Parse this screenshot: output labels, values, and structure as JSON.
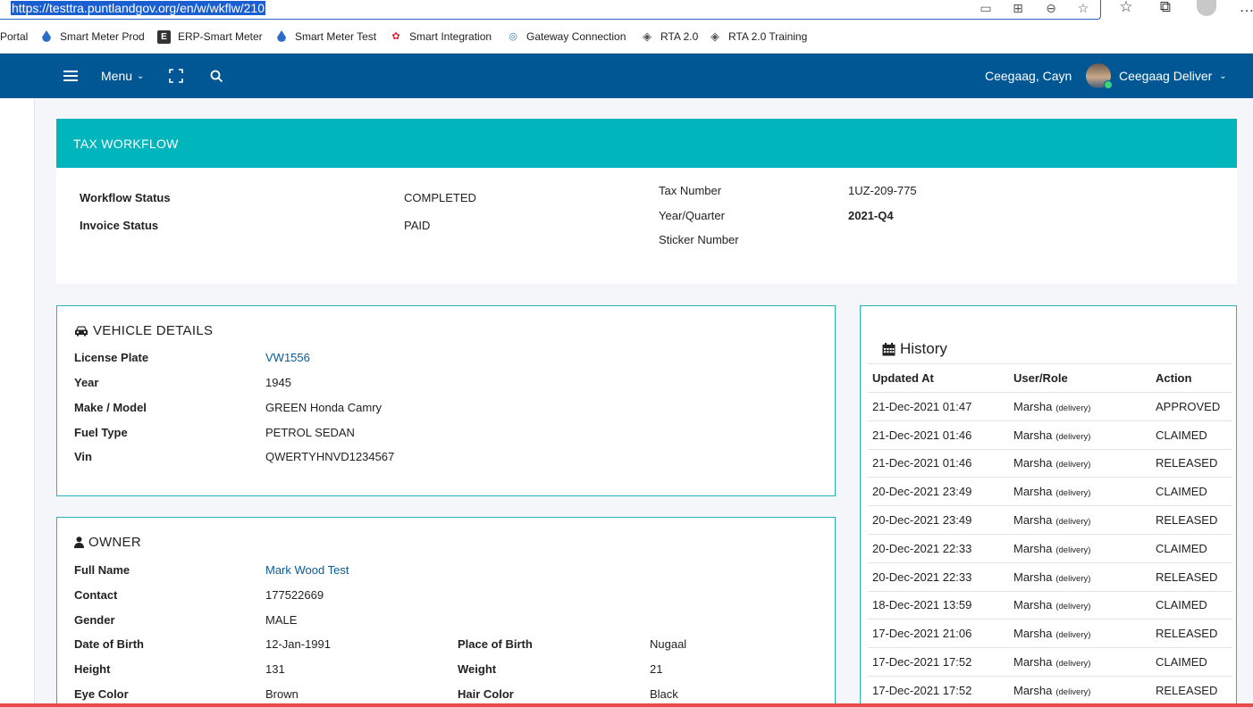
{
  "browser": {
    "url": "https://testtra.puntlandgov.org/en/w/wkflw/210"
  },
  "bookmarks": [
    {
      "label": "Portal",
      "icon": "none"
    },
    {
      "label": "Smart Meter Prod",
      "icon": "drop-icon"
    },
    {
      "label": "ERP-Smart Meter",
      "icon": "e-icon"
    },
    {
      "label": "Smart Meter Test",
      "icon": "drop-icon"
    },
    {
      "label": "Smart Integration",
      "icon": "huawei-icon"
    },
    {
      "label": "Gateway Connection",
      "icon": "gateway-icon"
    },
    {
      "label": "RTA 2.0",
      "icon": "layers-icon"
    },
    {
      "label": "RTA 2.0 Training",
      "icon": "layers-icon"
    }
  ],
  "header": {
    "menu_label": "Menu",
    "username": "Ceegaag, Cayn",
    "role_label": "Ceegaag Deliver"
  },
  "workflow": {
    "title": "TAX WORKFLOW",
    "workflow_status_label": "Workflow Status",
    "workflow_status_value": "COMPLETED",
    "invoice_status_label": "Invoice Status",
    "invoice_status_value": "PAID",
    "tax_number_label": "Tax Number",
    "tax_number_value": "1UZ-209-775",
    "year_quarter_label": "Year/Quarter",
    "year_quarter_value": "2021-Q4",
    "sticker_number_label": "Sticker Number"
  },
  "vehicle": {
    "title": "VEHICLE DETAILS",
    "license_plate_label": "License Plate",
    "license_plate_value": "VW1556",
    "year_label": "Year",
    "year_value": "1945",
    "make_model_label": "Make / Model",
    "make_model_value": "GREEN Honda Camry",
    "fuel_type_label": "Fuel Type",
    "fuel_type_value": "PETROL SEDAN",
    "vin_label": "Vin",
    "vin_value": "QWERTYHNVD1234567"
  },
  "owner": {
    "title": "OWNER",
    "full_name_label": "Full Name",
    "full_name_value": "Mark Wood Test",
    "contact_label": "Contact",
    "contact_value": "177522669",
    "gender_label": "Gender",
    "gender_value": "MALE",
    "dob_label": "Date of Birth",
    "dob_value": "12-Jan-1991",
    "pob_label": "Place of Birth",
    "pob_value": "Nugaal",
    "height_label": "Height",
    "height_value": "131",
    "weight_label": "Weight",
    "weight_value": "21",
    "eye_color_label": "Eye Color",
    "eye_color_value": "Brown",
    "hair_color_label": "Hair Color",
    "hair_color_value": "Black"
  },
  "history": {
    "title": "History",
    "columns": [
      "Updated At",
      "User/Role",
      "Action"
    ],
    "rows": [
      {
        "at": "21-Dec-2021 01:47",
        "user": "Marsha",
        "role": "(delivery)",
        "action": "APPROVED"
      },
      {
        "at": "21-Dec-2021 01:46",
        "user": "Marsha",
        "role": "(delivery)",
        "action": "CLAIMED"
      },
      {
        "at": "21-Dec-2021 01:46",
        "user": "Marsha",
        "role": "(delivery)",
        "action": "RELEASED"
      },
      {
        "at": "20-Dec-2021 23:49",
        "user": "Marsha",
        "role": "(delivery)",
        "action": "CLAIMED"
      },
      {
        "at": "20-Dec-2021 23:49",
        "user": "Marsha",
        "role": "(delivery)",
        "action": "RELEASED"
      },
      {
        "at": "20-Dec-2021 22:33",
        "user": "Marsha",
        "role": "(delivery)",
        "action": "CLAIMED"
      },
      {
        "at": "20-Dec-2021 22:33",
        "user": "Marsha",
        "role": "(delivery)",
        "action": "RELEASED"
      },
      {
        "at": "18-Dec-2021 13:59",
        "user": "Marsha",
        "role": "(delivery)",
        "action": "CLAIMED"
      },
      {
        "at": "17-Dec-2021 21:06",
        "user": "Marsha",
        "role": "(delivery)",
        "action": "RELEASED"
      },
      {
        "at": "17-Dec-2021 17:52",
        "user": "Marsha",
        "role": "(delivery)",
        "action": "CLAIMED"
      },
      {
        "at": "17-Dec-2021 17:52",
        "user": "Marsha",
        "role": "(delivery)",
        "action": "RELEASED"
      }
    ]
  },
  "colors": {
    "header_bg": "#005793",
    "workflow_header_bg": "#00b5bb",
    "card_border": "#22b1bd",
    "link": "#0a5a96"
  }
}
